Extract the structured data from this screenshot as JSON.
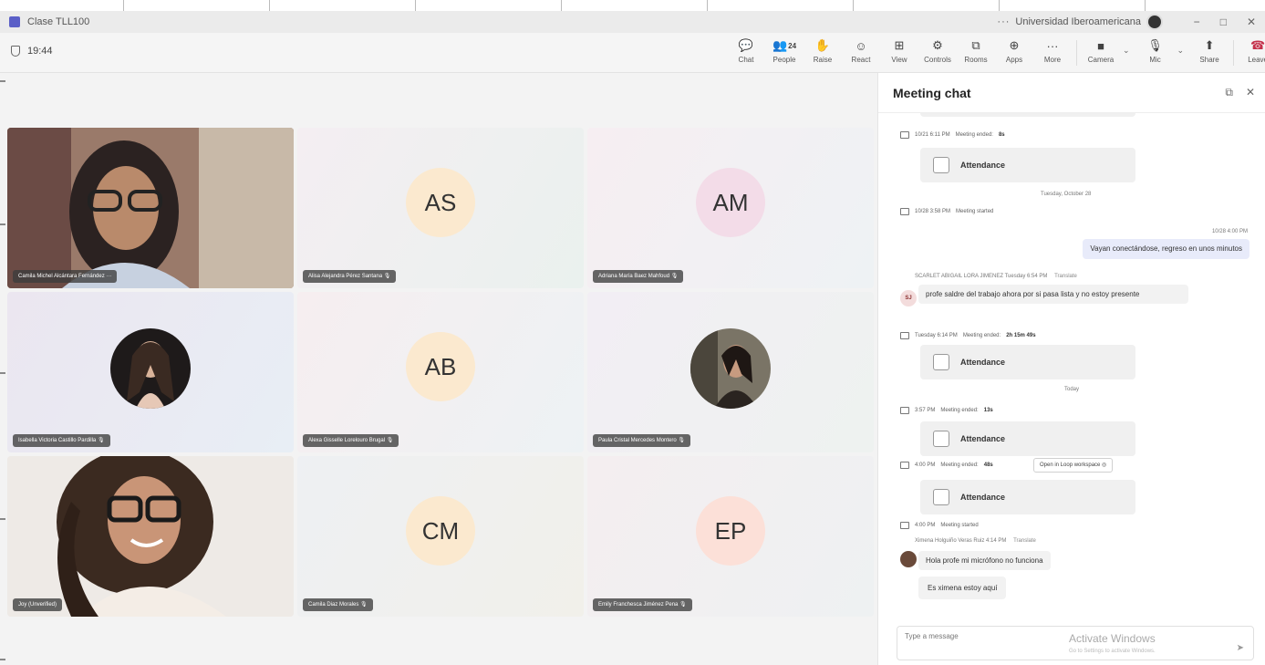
{
  "window": {
    "title": "Clase TLL100",
    "org": "Universidad Iberoamericana",
    "more": "···",
    "controls": [
      "−",
      "□",
      "✕"
    ]
  },
  "timer": "19:44",
  "toolbar": [
    {
      "label": "Chat",
      "icon": "chat-icon",
      "glyph": "💬"
    },
    {
      "label": "People",
      "icon": "people-icon",
      "glyph": "👥",
      "count": "24"
    },
    {
      "label": "Raise",
      "icon": "raise-hand-icon",
      "glyph": "✋"
    },
    {
      "label": "React",
      "icon": "react-icon",
      "glyph": "☺"
    },
    {
      "label": "View",
      "icon": "view-icon",
      "glyph": "⊞"
    },
    {
      "label": "Controls",
      "icon": "controls-icon",
      "glyph": "⚙"
    },
    {
      "label": "Rooms",
      "icon": "rooms-icon",
      "glyph": "⧉"
    },
    {
      "label": "Apps",
      "icon": "apps-icon",
      "glyph": "⊕"
    },
    {
      "label": "More",
      "icon": "more-icon",
      "glyph": "···"
    }
  ],
  "media": {
    "camera": {
      "label": "Camera",
      "glyph": "■"
    },
    "mic": {
      "label": "Mic",
      "glyph": "🎙"
    },
    "share": {
      "label": "Share",
      "glyph": "⬆"
    },
    "leave": {
      "label": "Leave",
      "glyph": "☎"
    }
  },
  "participants": [
    {
      "name": "Camila Michel Alcántara Fernández",
      "type": "video",
      "more": "···"
    },
    {
      "name": "Alisa Alejandra Pérez Santana",
      "type": "initials",
      "initials": "AS",
      "color": "#fbe9cf",
      "muted": "🎙"
    },
    {
      "name": "Adriana María Baez Mahfoud",
      "type": "initials",
      "initials": "AM",
      "color": "#f3dce8",
      "muted": "🎙"
    },
    {
      "name": "Isabella Victoria Castillo Pardilla",
      "type": "photo",
      "muted": "🎙"
    },
    {
      "name": "Alexa Gisselle Lorelouro Brugal",
      "type": "initials",
      "initials": "AB",
      "color": "#fbe9cf",
      "muted": "🎙"
    },
    {
      "name": "Paula Cristal Mercedes Montero",
      "type": "photo",
      "muted": "🎙"
    },
    {
      "name": "Joy (Unverified)",
      "type": "video"
    },
    {
      "name": "Camila Diaz Morales",
      "type": "initials",
      "initials": "CM",
      "color": "#fbe9cf",
      "muted": "🎙"
    },
    {
      "name": "Emily Franchesca Jiménez Pena",
      "type": "initials",
      "initials": "EP",
      "color": "#fce0d8",
      "muted": "🎙"
    }
  ],
  "chat": {
    "title": "Meeting chat",
    "events": [
      {
        "time": "10/21 6:11 PM",
        "text": "Meeting ended:",
        "duration": "8s"
      },
      {
        "time": "10/28 3:58 PM",
        "text": "Meeting started"
      },
      {
        "time": "Tuesday 6:14 PM",
        "text": "Meeting ended:",
        "duration": "2h 15m 49s"
      },
      {
        "time": "3:57 PM",
        "text": "Meeting ended:",
        "duration": "13s"
      },
      {
        "time": "4:00 PM",
        "text": "Meeting ended:",
        "duration": "48s"
      },
      {
        "time": "4:00 PM",
        "text": "Meeting started"
      }
    ],
    "attendance": "Attendance",
    "day_tuesday": "Tuesday, October 28",
    "day_today": "Today",
    "my_message": {
      "time": "10/28 4:00 PM",
      "text": "Vayan conectándose, regreso en unos minutos"
    },
    "scarlet": {
      "sender": "SCARLET ABIGAIL LORA JIMENEZ",
      "time": "Tuesday 6:54 PM",
      "translate": "Translate",
      "initials": "SJ",
      "text": "profe saldre del trabajo ahora por si pasa lista y no estoy presente"
    },
    "loop": "Open in Loop workspace",
    "ximena": {
      "sender": "Ximena Holguiño Veras Ruiz",
      "time": "4:14 PM",
      "translate": "Translate",
      "msg1": "Hola profe mi micrófono no funciona",
      "msg2": "Es ximena estoy aquí"
    },
    "placeholder": "Type a message",
    "watermark": "Activate Windows",
    "watermark2": "Go to Settings to activate Windows."
  }
}
